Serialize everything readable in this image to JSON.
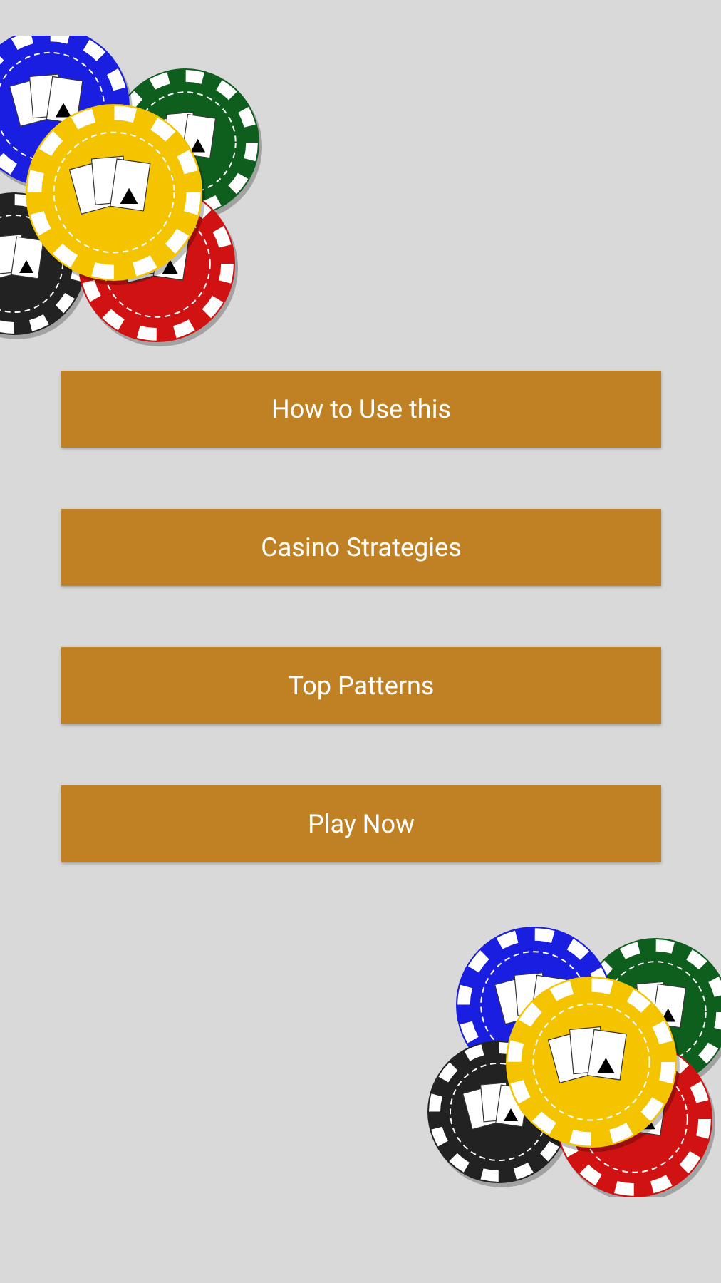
{
  "buttons": [
    {
      "label": "How to Use this"
    },
    {
      "label": "Casino Strategies"
    },
    {
      "label": "Top Patterns"
    },
    {
      "label": "Play Now"
    }
  ]
}
